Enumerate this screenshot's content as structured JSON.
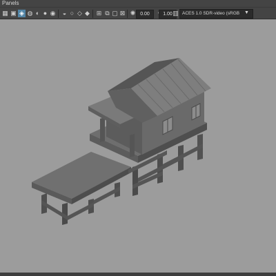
{
  "panel": {
    "title": "Panels"
  },
  "toolbar": {
    "exposure_value": "0.00",
    "gamma_value": "1.00",
    "color_space_label": "ACES 1.0 SDR-video (sRGB"
  },
  "icons": {
    "grid": "grid-icon",
    "film_gate": "film-gate-icon",
    "resolution_gate": "resolution-gate-icon",
    "wireframe": "wireframe-icon",
    "smooth_shade": "smooth-shade-icon",
    "textured": "textured-icon",
    "lights": "lights-icon",
    "shadows": "shadows-icon",
    "xray": "xray-icon",
    "isolate": "isolate-icon",
    "camera_lock": "camera-lock-icon",
    "exposure": "exposure-icon",
    "gamma": "gamma-icon"
  },
  "colors": {
    "ui_bg": "#444444",
    "viewport_bg": "#9c9c9c",
    "active_button": "#5285a6",
    "model_gray": "#6b6b6b"
  }
}
